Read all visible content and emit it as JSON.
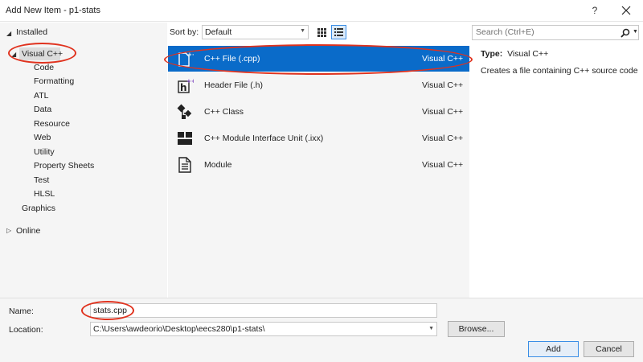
{
  "window": {
    "title": "Add New Item - p1-stats",
    "help_label": "?"
  },
  "tree": {
    "installed": "Installed",
    "visual_cpp": "Visual C++",
    "children": [
      "Code",
      "Formatting",
      "ATL",
      "Data",
      "Resource",
      "Web",
      "Utility",
      "Property Sheets",
      "Test",
      "HLSL"
    ],
    "graphics": "Graphics",
    "online": "Online"
  },
  "sort": {
    "label": "Sort by:",
    "value": "Default"
  },
  "templates": [
    {
      "name": "C++ File (.cpp)",
      "lang": "Visual C++",
      "icon": "cpp-file-icon",
      "selected": true
    },
    {
      "name": "Header File (.h)",
      "lang": "Visual C++",
      "icon": "header-file-icon",
      "selected": false
    },
    {
      "name": "C++ Class",
      "lang": "Visual C++",
      "icon": "cpp-class-icon",
      "selected": false
    },
    {
      "name": "C++ Module Interface Unit (.ixx)",
      "lang": "Visual C++",
      "icon": "module-interface-icon",
      "selected": false
    },
    {
      "name": "Module",
      "lang": "Visual C++",
      "icon": "module-icon",
      "selected": false
    }
  ],
  "search": {
    "placeholder": "Search (Ctrl+E)"
  },
  "details": {
    "type_label": "Type:",
    "type_value": "Visual C++",
    "description": "Creates a file containing C++ source code"
  },
  "form": {
    "name_label": "Name:",
    "name_value": "stats.cpp",
    "location_label": "Location:",
    "location_value": "C:\\Users\\awdeorio\\Desktop\\eecs280\\p1-stats\\",
    "browse_label": "Browse...",
    "add_label": "Add",
    "cancel_label": "Cancel"
  },
  "colors": {
    "accent": "#0a6bc9",
    "annotation": "#e0321e"
  }
}
